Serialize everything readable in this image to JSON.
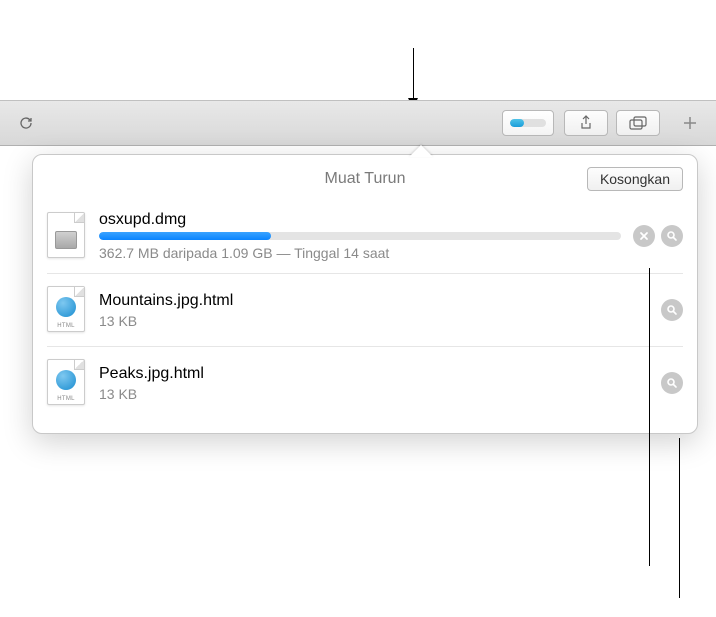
{
  "popover": {
    "title": "Muat Turun",
    "clear_label": "Kosongkan"
  },
  "downloads": [
    {
      "name": "osxupd.dmg",
      "status": "362.7 MB daripada 1.09 GB — Tinggal 14 saat",
      "progress_percent": 33,
      "in_progress": true,
      "type": "dmg"
    },
    {
      "name": "Mountains.jpg.html",
      "status": "13 KB",
      "in_progress": false,
      "type": "html"
    },
    {
      "name": "Peaks.jpg.html",
      "status": "13 KB",
      "in_progress": false,
      "type": "html"
    }
  ],
  "icon_labels": {
    "html": "HTML"
  }
}
